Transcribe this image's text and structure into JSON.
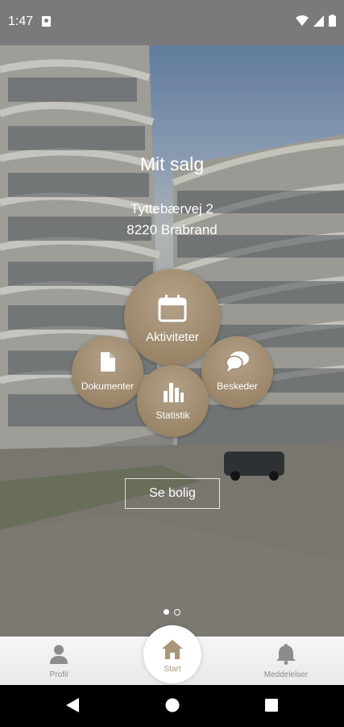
{
  "status_bar": {
    "time": "1:47"
  },
  "hero": {
    "title": "Mit salg",
    "address_line1": "Tyttebærvej 2",
    "address_line2": "8220 Brabrand"
  },
  "bubbles": {
    "aktiviteter": {
      "label": "Aktiviteter",
      "icon": "calendar-icon"
    },
    "dokumenter": {
      "label": "Dokumenter",
      "icon": "document-icon"
    },
    "beskeder": {
      "label": "Beskeder",
      "icon": "chat-icon"
    },
    "statistik": {
      "label": "Statistik",
      "icon": "bar-chart-icon"
    }
  },
  "se_bolig_label": "Se bolig",
  "pager": {
    "pages": 2,
    "active": 1
  },
  "bottom_nav": {
    "profil": "Profil",
    "start": "Start",
    "meddelelser": "Meddelelser"
  },
  "colors": {
    "accent": "#9b8669",
    "nav_active": "#a89679",
    "nav_inactive": "#8c8c8c"
  }
}
